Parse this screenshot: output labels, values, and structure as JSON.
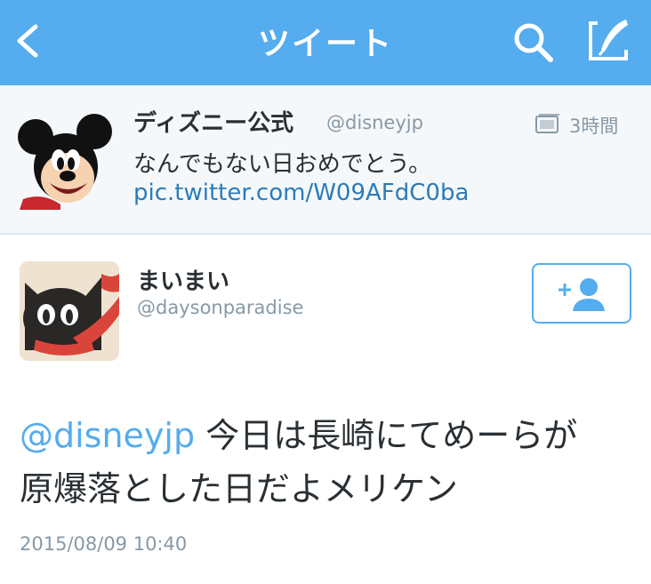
{
  "navbar": {
    "title": "ツイート",
    "back_icon": "chevron-left-icon",
    "search_icon": "search-icon",
    "compose_icon": "compose-quill-icon",
    "background_color": "#55acee"
  },
  "quoted_tweet": {
    "author_name": "ディズニー公式",
    "author_handle": "@disneyjp",
    "time": "3時間",
    "text": "なんでもない日おめでとう。",
    "link": "pic.twitter.com/W09AFdC0ba",
    "avatar_icon": "mickey-mouse-avatar",
    "time_icon": "image-media-icon"
  },
  "tweet": {
    "author_name": "まいまい",
    "author_handle": "@daysonparadise",
    "avatar_icon": "black-cat-avatar",
    "follow_icon": "add-user-icon",
    "mention": "@disneyjp",
    "body_line1": " 今日は長崎にてめーらが",
    "body_line2": "原爆落とした日だよメリケン",
    "timestamp": "2015/08/09 10:40"
  },
  "colors": {
    "accent": "#55acee",
    "link": "#2b7bb9",
    "muted": "#8899a6",
    "text": "#292f33"
  }
}
